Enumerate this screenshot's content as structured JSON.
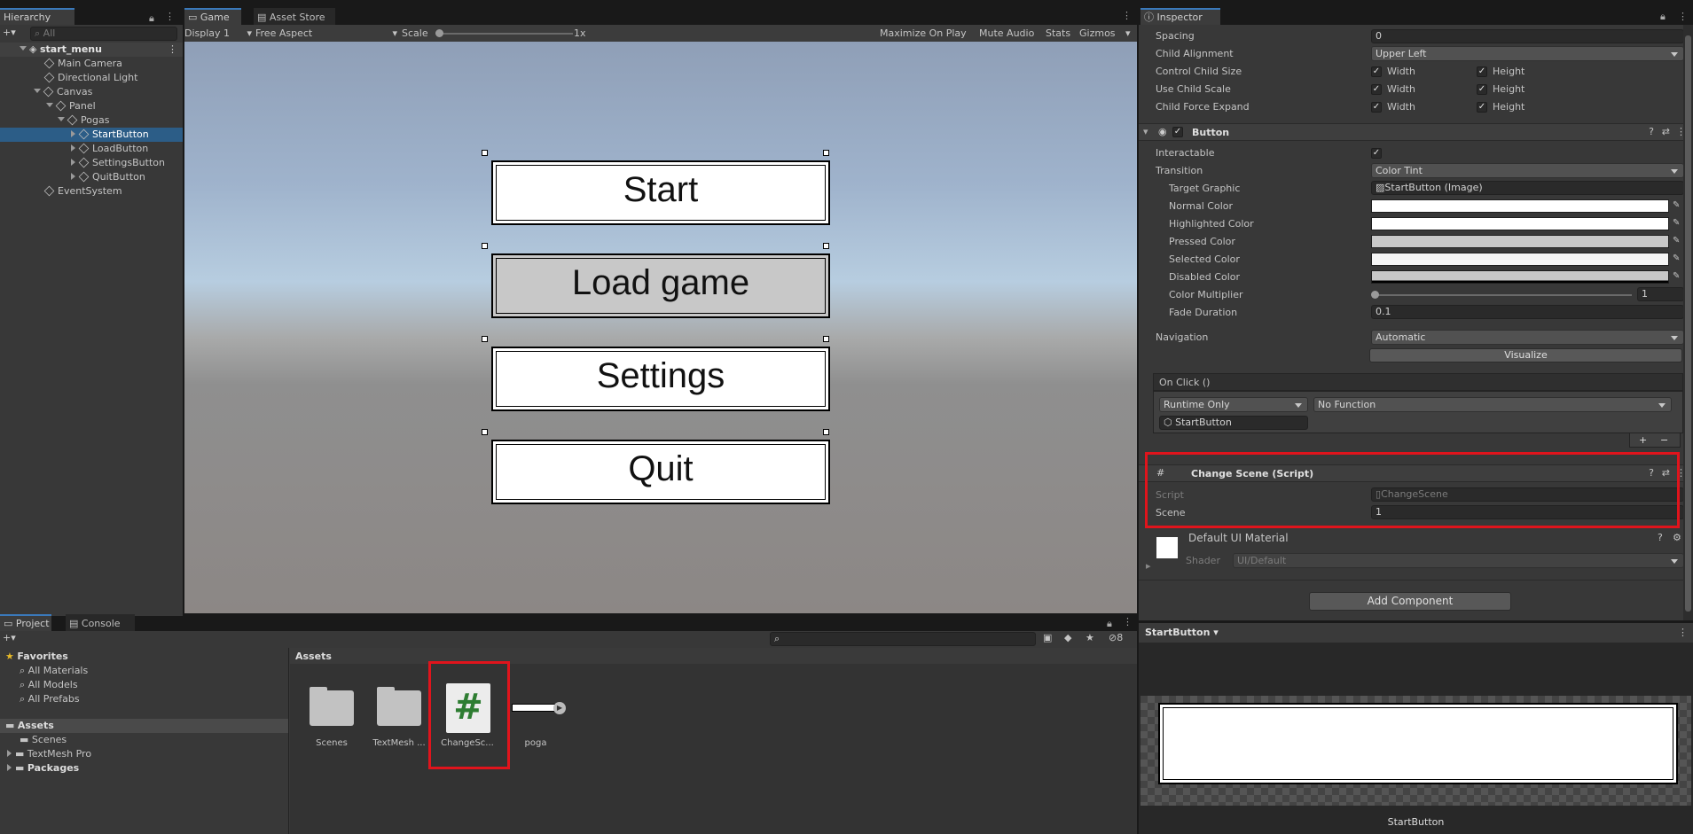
{
  "colors": {
    "accent": "#3a79bb",
    "selection": "#2c5d87",
    "highlight": "#e0141c",
    "panel": "#383838"
  },
  "hierarchy": {
    "tab": "Hierarchy",
    "search_placeholder": "All",
    "scene": "start_menu",
    "items": [
      "Main Camera",
      "Directional Light",
      "Canvas",
      "Panel",
      "Pogas",
      "StartButton",
      "LoadButton",
      "SettingsButton",
      "QuitButton",
      "EventSystem"
    ]
  },
  "game": {
    "tabs": [
      "Game",
      "Asset Store"
    ],
    "display": "Display 1",
    "aspect": "Free Aspect",
    "scale_label": "Scale",
    "scale_value": "1x",
    "toggles": [
      "Maximize On Play",
      "Mute Audio",
      "Stats",
      "Gizmos"
    ],
    "buttons": [
      "Start",
      "Load game",
      "Settings",
      "Quit"
    ]
  },
  "inspector": {
    "tab": "Inspector",
    "layout": {
      "spacing_label": "Spacing",
      "spacing": "0",
      "child_alignment_label": "Child Alignment",
      "child_alignment": "Upper Left",
      "control_child_size": "Control Child Size",
      "use_child_scale": "Use Child Scale",
      "child_force_expand": "Child Force Expand",
      "width": "Width",
      "height": "Height"
    },
    "button": {
      "title": "Button",
      "interactable": "Interactable",
      "transition_label": "Transition",
      "transition": "Color Tint",
      "target_graphic_label": "Target Graphic",
      "target_graphic": "StartButton (Image)",
      "normal": "Normal Color",
      "highlighted": "Highlighted Color",
      "pressed": "Pressed Color",
      "selected": "Selected Color",
      "disabled": "Disabled Color",
      "multiplier_label": "Color Multiplier",
      "multiplier": "1",
      "fade_label": "Fade Duration",
      "fade": "0.1",
      "navigation_label": "Navigation",
      "navigation": "Automatic",
      "visualize": "Visualize",
      "onclick": "On Click ()",
      "runtime": "Runtime Only",
      "function": "No Function",
      "target": "StartButton",
      "plus": "+",
      "minus": "−"
    },
    "script": {
      "title": "Change Scene (Script)",
      "script_label": "Script",
      "script": "ChangeScene",
      "scene_label": "Scene",
      "scene": "1"
    },
    "material": {
      "title": "Default UI Material",
      "shader_label": "Shader",
      "shader": "UI/Default"
    },
    "add_component": "Add Component",
    "preview_title": "StartButton",
    "preview_caption": "StartButton"
  },
  "project": {
    "tabs": [
      "Project",
      "Console"
    ],
    "favorites": "Favorites",
    "fav_items": [
      "All Materials",
      "All Models",
      "All Prefabs"
    ],
    "assets": "Assets",
    "asset_items": [
      "Scenes",
      "TextMesh Pro"
    ],
    "packages": "Packages",
    "breadcrumb": "Assets",
    "files": [
      "Scenes",
      "TextMesh ...",
      "ChangeSc...",
      "poga"
    ],
    "count": "8"
  }
}
